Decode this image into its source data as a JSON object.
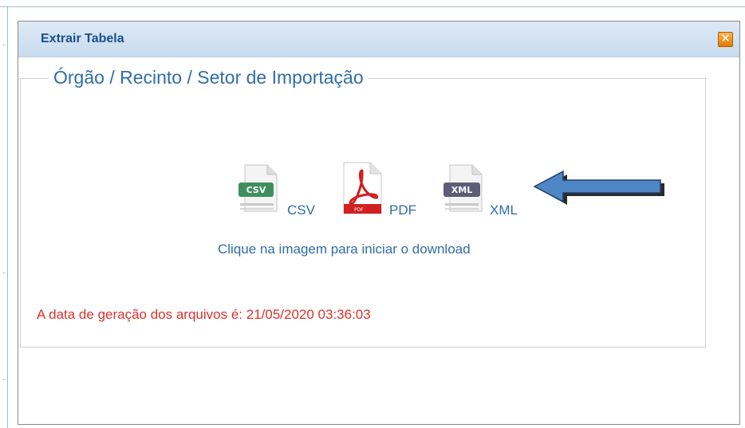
{
  "dialog": {
    "title": "Extrair Tabela",
    "close_glyph": "✕"
  },
  "section": {
    "legend": "Órgão / Recinto / Setor de Importação"
  },
  "downloads": [
    {
      "format": "CSV",
      "badge": "CSV",
      "icon": "csv-file-icon",
      "color": "#3f8f5e"
    },
    {
      "format": "PDF",
      "badge": "PDF",
      "icon": "pdf-file-icon",
      "color": "#d21f1f"
    },
    {
      "format": "XML",
      "badge": "XML",
      "icon": "xml-file-icon",
      "color": "#5d5d7a"
    }
  ],
  "hint": "Clique na imagem para iniciar o download",
  "generation_notice": "A data de geração dos arquivos é: 21/05/2020 03:36:03",
  "annotation": {
    "icon": "arrow-left-icon",
    "color": "#4f86c6"
  },
  "colors": {
    "title": "#1d4f8c",
    "link": "#2f6da8",
    "notice": "#e0302a",
    "close": "#f08a12"
  }
}
